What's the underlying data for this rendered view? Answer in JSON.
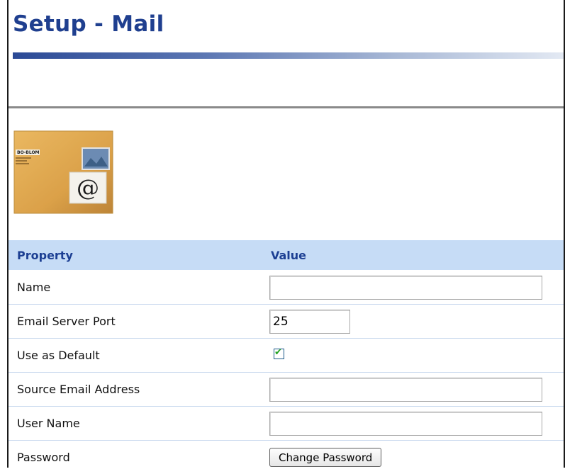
{
  "page": {
    "title": "Setup - Mail"
  },
  "icon": {
    "name": "mail-envelope-icon",
    "label_text": "BO-BLOM",
    "symbol": "@"
  },
  "table": {
    "headers": [
      "Property",
      "Value"
    ],
    "rows": [
      {
        "label": "Name",
        "value": ""
      },
      {
        "label": "Email Server Port",
        "value": "25"
      },
      {
        "label": "Use as Default",
        "checked": true
      },
      {
        "label": "Source Email Address",
        "value": ""
      },
      {
        "label": "User Name",
        "value": ""
      },
      {
        "label": "Password",
        "button": "Change Password"
      }
    ]
  },
  "colors": {
    "title": "#1f3f8f",
    "header_bg": "#c6dcf6",
    "header_text": "#1c3f93",
    "check": "#21a121"
  }
}
